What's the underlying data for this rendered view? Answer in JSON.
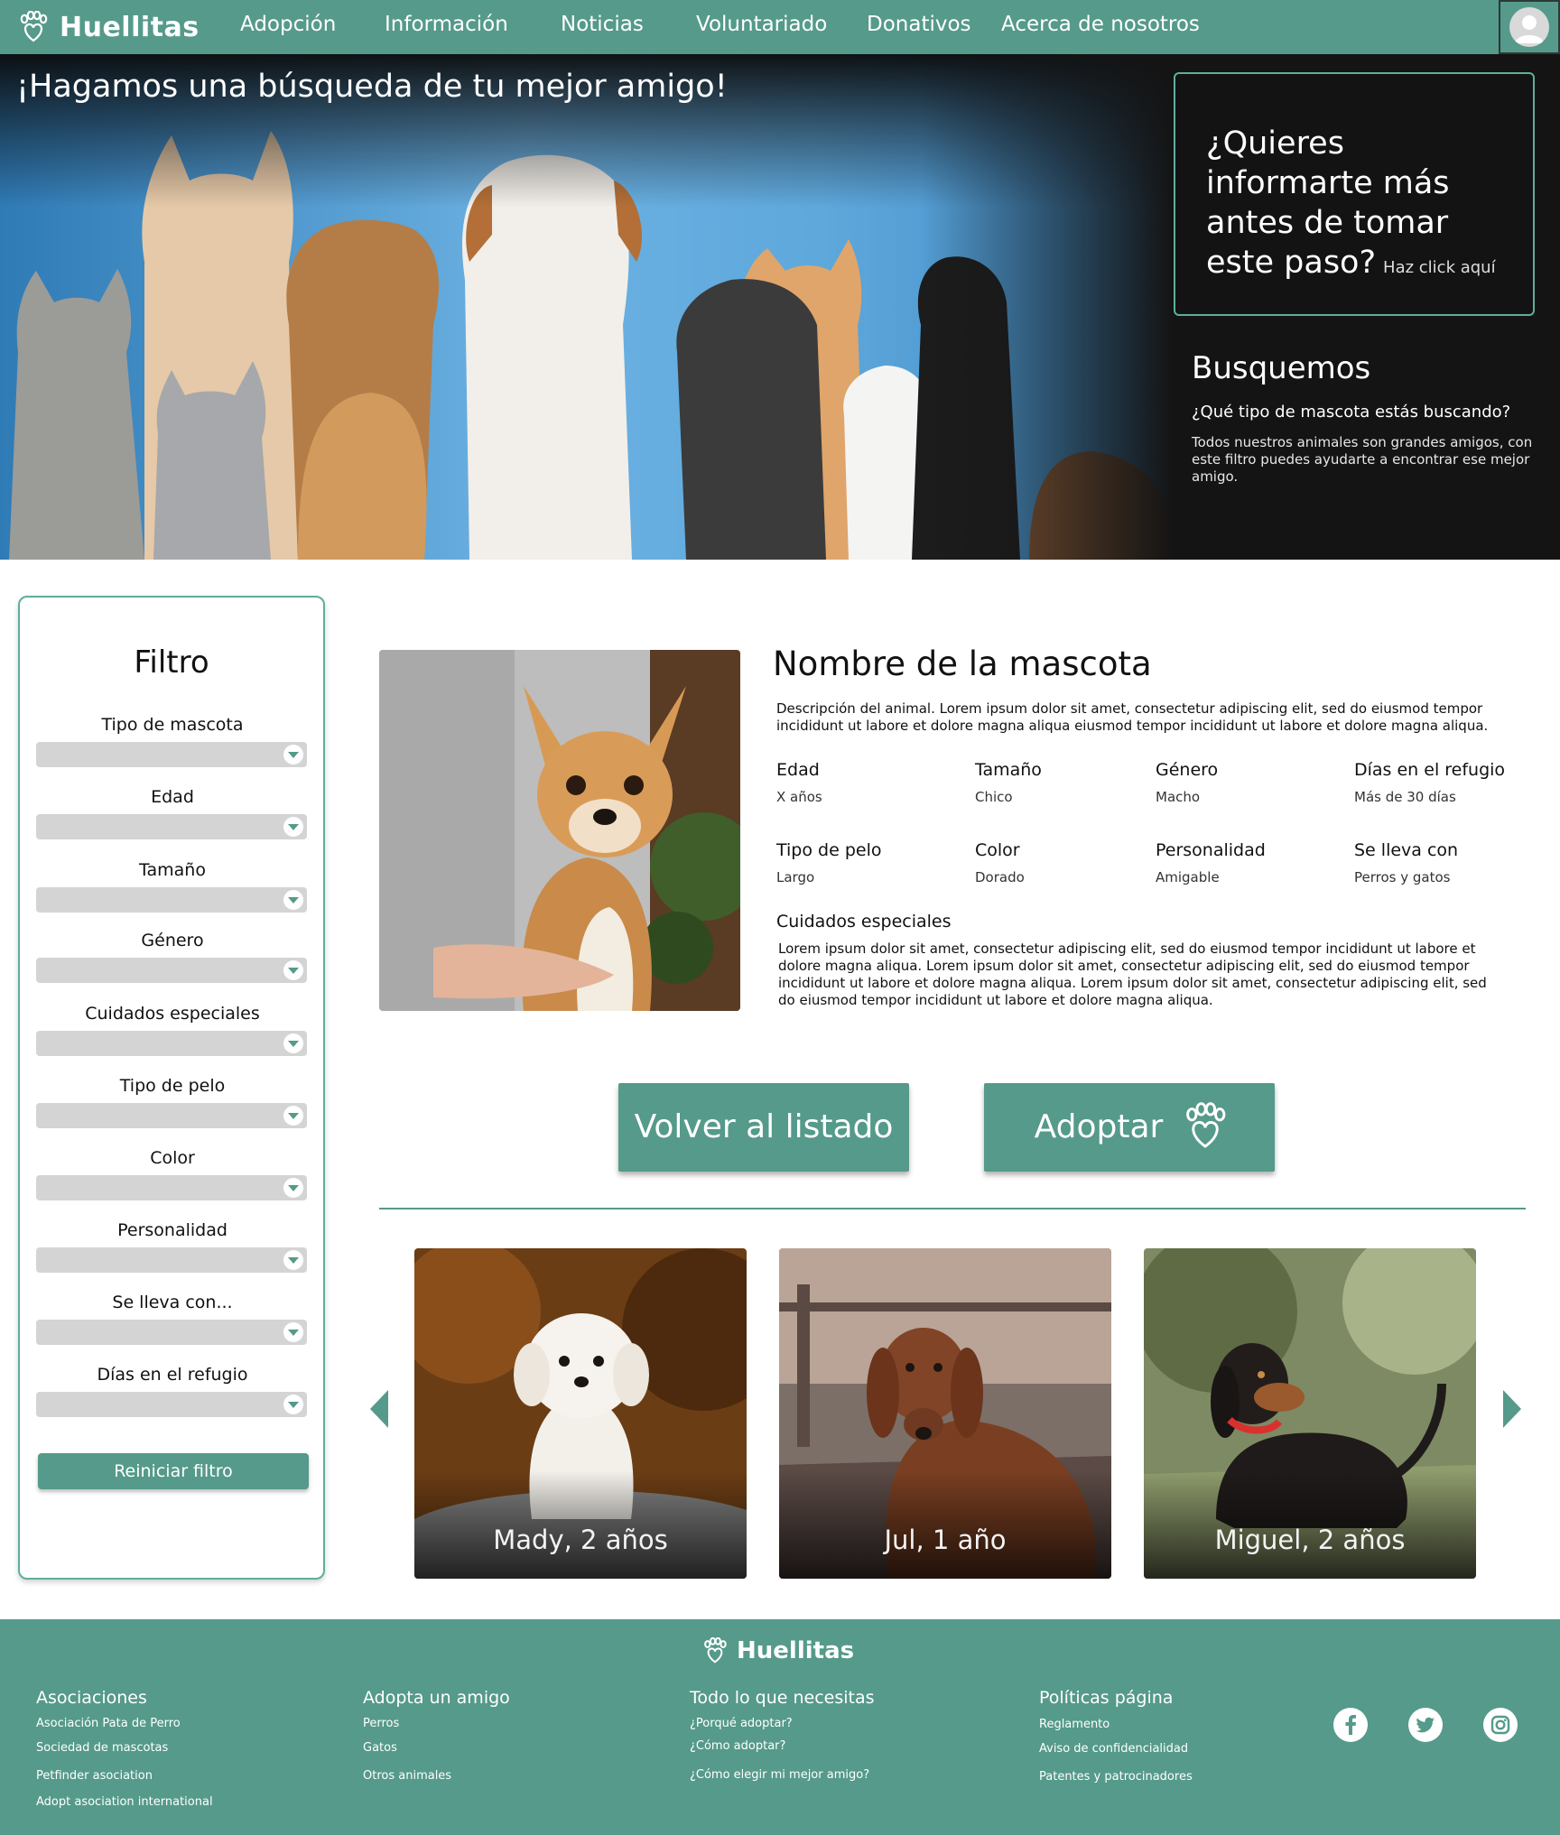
{
  "nav": {
    "brand": "Huellitas",
    "items": [
      "Adopción",
      "Información",
      "Noticias",
      "Voluntariado",
      "Donativos",
      "Acerca de nosotros"
    ]
  },
  "hero": {
    "headline": "¡Hagamos una búsqueda de tu mejor amigo!",
    "info_question": "¿Quieres informarte más antes de tomar este paso?",
    "info_link": "Haz click aquí",
    "search_title": "Busquemos",
    "search_subtitle": "¿Qué tipo de mascota estás buscando?",
    "search_desc": "Todos nuestros animales son grandes amigos, con este filtro puedes ayudarte a encontrar ese mejor amigo."
  },
  "filter": {
    "title": "Filtro",
    "groups": [
      "Tipo de mascota",
      "Edad",
      "Tamaño",
      "Género",
      "Cuidados especiales",
      "Tipo de pelo",
      "Color",
      "Personalidad",
      "Se lleva con...",
      "Días en el refugio"
    ],
    "reset_label": "Reiniciar filtro"
  },
  "pet": {
    "name": "Nombre de la mascota",
    "description": "Descripción del animal. Lorem ipsum dolor sit amet, consectetur adipiscing elit, sed do eiusmod tempor incididunt ut labore et dolore magna aliqua eiusmod tempor incididunt ut labore et dolore magna aliqua.",
    "attributes": [
      {
        "key": "Edad",
        "value": "X años"
      },
      {
        "key": "Tamaño",
        "value": "Chico"
      },
      {
        "key": "Género",
        "value": "Macho"
      },
      {
        "key": "Días en el refugio",
        "value": "Más de 30 días"
      },
      {
        "key": "Tipo de pelo",
        "value": "Largo"
      },
      {
        "key": "Color",
        "value": "Dorado"
      },
      {
        "key": "Personalidad",
        "value": "Amigable"
      },
      {
        "key": "Se lleva con",
        "value": "Perros y gatos"
      }
    ],
    "care_title": "Cuidados especiales",
    "care_text": "Lorem ipsum dolor sit amet, consectetur adipiscing elit, sed do eiusmod tempor incididunt ut labore et dolore magna aliqua. Lorem ipsum dolor sit amet, consectetur adipiscing elit, sed do eiusmod tempor incididunt ut labore et dolore magna aliqua. Lorem ipsum dolor sit amet, consectetur adipiscing elit, sed do eiusmod tempor incididunt ut labore et dolore magna aliqua."
  },
  "actions": {
    "back_label": "Volver al listado",
    "adopt_label": "Adoptar"
  },
  "carousel": {
    "cards": [
      "Mady, 2 años",
      "Jul, 1 año",
      "Miguel, 2 años"
    ]
  },
  "footer": {
    "brand": "Huellitas",
    "columns": [
      {
        "title": "Asociaciones",
        "links": [
          "Asociación Pata de Perro",
          "Sociedad de mascotas",
          "Petfinder asociation",
          "Adopt asociation international"
        ]
      },
      {
        "title": "Adopta un amigo",
        "links": [
          "Perros",
          "Gatos",
          "Otros animales"
        ]
      },
      {
        "title": "Todo lo que necesitas",
        "links": [
          "¿Porqué adoptar?",
          "¿Cómo adoptar?",
          "¿Cómo elegir mi mejor amigo?"
        ]
      },
      {
        "title": "Políticas página",
        "links": [
          "Reglamento",
          "Aviso de confidencialidad",
          "Patentes y patrocinadores"
        ]
      }
    ],
    "social": [
      "facebook-icon",
      "twitter-icon",
      "instagram-icon"
    ]
  },
  "colors": {
    "brand": "#559a8a",
    "accent_border": "#5fae9c",
    "dark_panel": "#141414"
  }
}
